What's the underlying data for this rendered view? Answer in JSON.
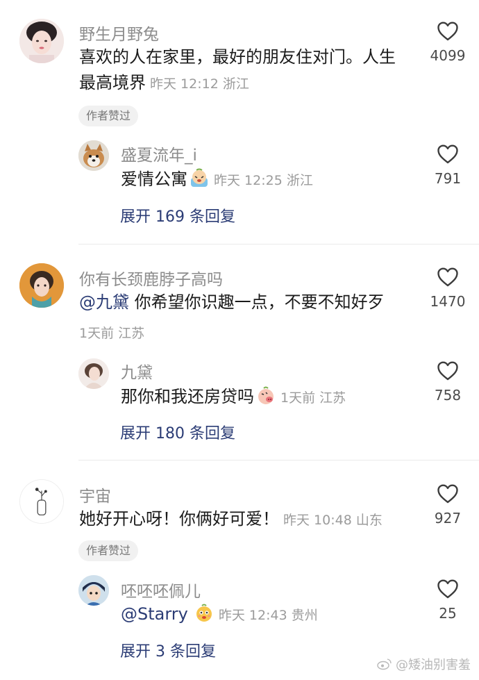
{
  "comments": [
    {
      "user": "野生月野兔",
      "text": "喜欢的人在家里，最好的朋友住对门。人生最高境界",
      "text_line1": "喜欢的人在家里，最好的朋友住对门。人生",
      "text_line2": "最高境界",
      "time": "昨天 12:12 浙江",
      "likes": "4099",
      "badge": "作者赞过",
      "reply": {
        "user": "盛夏流年_i",
        "text": "爱情公寓",
        "time": "昨天 12:25 浙江",
        "likes": "791"
      },
      "expand": "展开 169 条回复"
    },
    {
      "user": "你有长颈鹿脖子高吗",
      "mention": "@九黛",
      "text": "你希望你识趣一点，不要不知好歹",
      "time": "1天前 江苏",
      "likes": "1470",
      "reply": {
        "user": "九黛",
        "text": "那你和我还房贷吗",
        "time": "1天前 江苏",
        "likes": "758"
      },
      "expand": "展开 180 条回复"
    },
    {
      "user": "宇宙",
      "text": "她好开心呀！你俩好可爱！",
      "time": "昨天 10:48 山东",
      "likes": "927",
      "badge": "作者赞过",
      "reply": {
        "user": "呸呸呸佩儿",
        "mention": "@Starry",
        "time": "昨天 12:43 贵州",
        "likes": "25"
      },
      "expand": "展开 3 条回复"
    }
  ],
  "watermark": "@矮油别害羞",
  "icons": {
    "like": "heart-outline-icon",
    "watermark": "weibo-logo-icon"
  },
  "colors": {
    "link": "#2b3c75",
    "name": "#8c8c8c",
    "meta": "#9b9b9b"
  }
}
